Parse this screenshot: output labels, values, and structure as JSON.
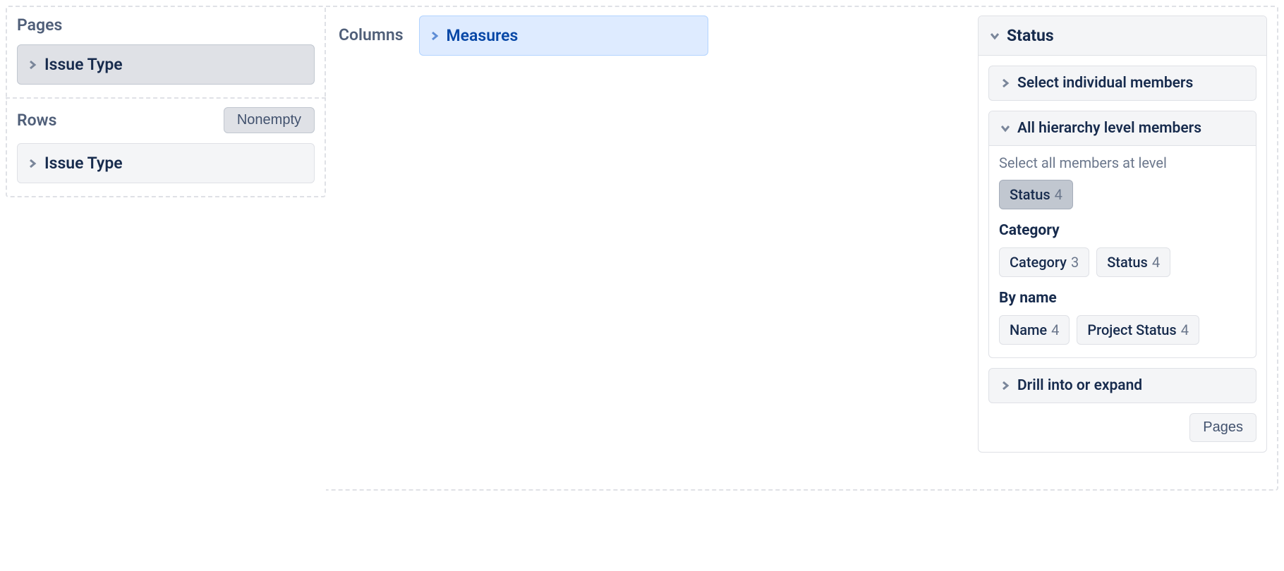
{
  "pages": {
    "title": "Pages",
    "item_label": "Issue Type"
  },
  "rows": {
    "title": "Rows",
    "nonempty_label": "Nonempty",
    "item_label": "Issue Type"
  },
  "columns": {
    "title": "Columns",
    "measures_label": "Measures"
  },
  "status_panel": {
    "title": "Status",
    "select_members_label": "Select individual members",
    "hierarchy_label": "All hierarchy level members",
    "helper_text": "Select all members at level",
    "level_status": {
      "label": "Status",
      "count": "4"
    },
    "category_heading": "Category",
    "category_chips": [
      {
        "label": "Category",
        "count": "3"
      },
      {
        "label": "Status",
        "count": "4"
      }
    ],
    "byname_heading": "By name",
    "byname_chips": [
      {
        "label": "Name",
        "count": "4"
      },
      {
        "label": "Project Status",
        "count": "4"
      }
    ],
    "drill_label": "Drill into or expand",
    "pages_button": "Pages"
  }
}
